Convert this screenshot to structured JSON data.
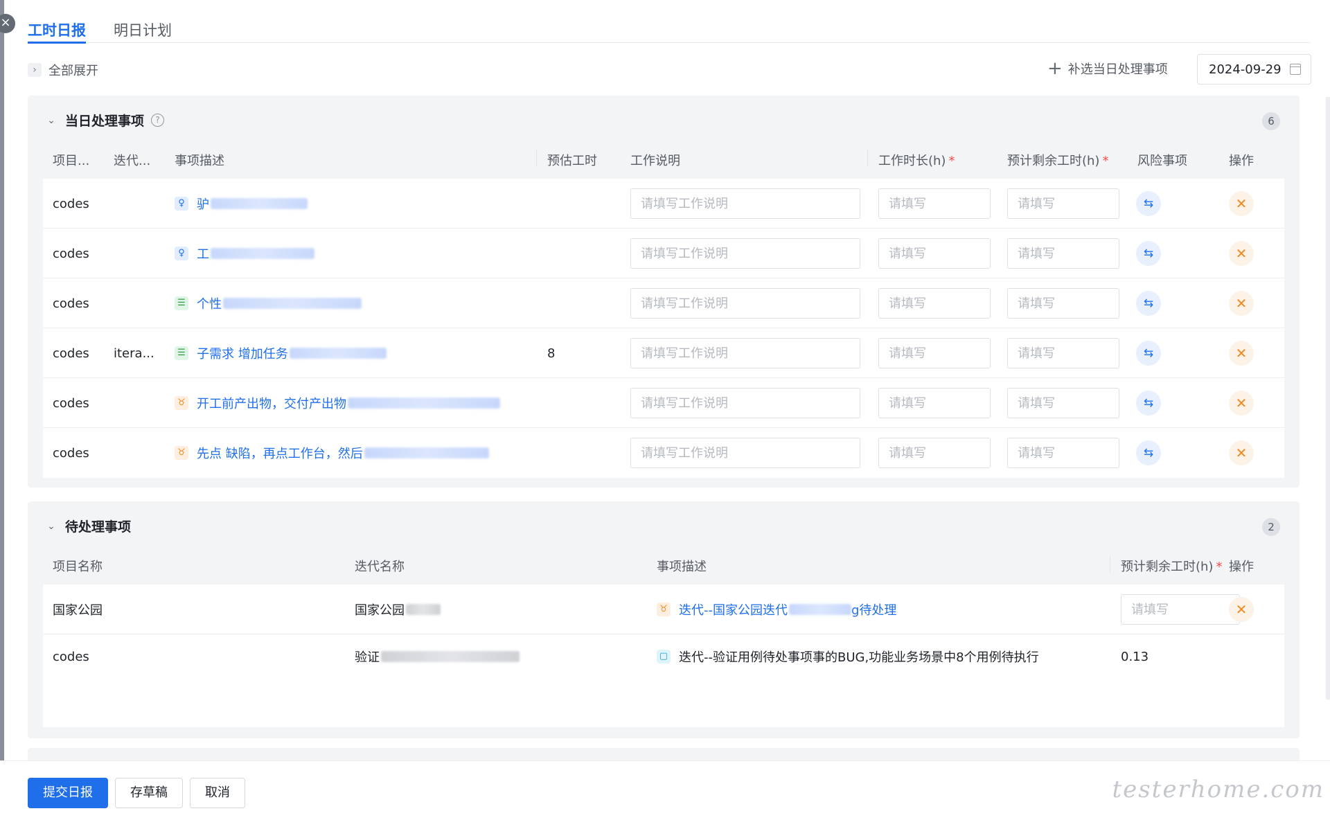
{
  "tabs": [
    {
      "label": "工时日报",
      "active": true
    },
    {
      "label": "明日计划",
      "active": false
    }
  ],
  "toolbar": {
    "expand_all": "全部展开",
    "add_items": "补选当日处理事项",
    "date": "2024-09-29"
  },
  "today_section": {
    "title": "当日处理事项",
    "count": "6",
    "headers": {
      "project": "项目...",
      "iteration": "迭代...",
      "desc": "事项描述",
      "estimate": "预估工时",
      "note": "工作说明",
      "hours": "工作时长(h)",
      "remaining": "预计剩余工时(h)",
      "risk": "风险事项",
      "action": "操作"
    },
    "note_placeholder": "请填写工作说明",
    "hours_placeholder": "请填写",
    "remaining_placeholder": "请填写",
    "rows": [
      {
        "project": "codes",
        "iteration": "",
        "type": "requirement",
        "desc": "驴",
        "estimate": ""
      },
      {
        "project": "codes",
        "iteration": "",
        "type": "requirement",
        "desc": "工",
        "estimate": ""
      },
      {
        "project": "codes",
        "iteration": "",
        "type": "task",
        "desc": "个性",
        "estimate": ""
      },
      {
        "project": "codes",
        "iteration": "itera...",
        "type": "task",
        "desc": "子需求 增加任务",
        "estimate": "8"
      },
      {
        "project": "codes",
        "iteration": "",
        "type": "bug",
        "desc": "开工前产出物，交付产出物",
        "estimate": ""
      },
      {
        "project": "codes",
        "iteration": "",
        "type": "bug",
        "desc": "先点 缺陷，再点工作台，然后",
        "estimate": ""
      }
    ]
  },
  "pending_section": {
    "title": "待处理事项",
    "count": "2",
    "headers": {
      "project": "项目名称",
      "iteration": "迭代名称",
      "desc": "事项描述",
      "remaining": "预计剩余工时(h)",
      "action": "操作"
    },
    "remaining_placeholder": "请填写",
    "rows": [
      {
        "project": "国家公园",
        "iteration": "国家公园",
        "type": "bug",
        "desc_prefix": "迭代--国家公园迭代",
        "desc_suffix": "g待处理",
        "remaining": ""
      },
      {
        "project": "codes",
        "iteration": "验证",
        "type": "case",
        "desc_prefix": "迭代--验证用例待处事项事的BUG,功能业务场景中8个用例待执行",
        "desc_suffix": "",
        "remaining": "0.13"
      }
    ]
  },
  "footer": {
    "submit": "提交日报",
    "draft": "存草稿",
    "cancel": "取消"
  },
  "watermark": "testerhome.com",
  "colors": {
    "primary": "#1f6feb",
    "danger_orange": "#f08a24",
    "panel_bg": "#f3f4f6"
  }
}
